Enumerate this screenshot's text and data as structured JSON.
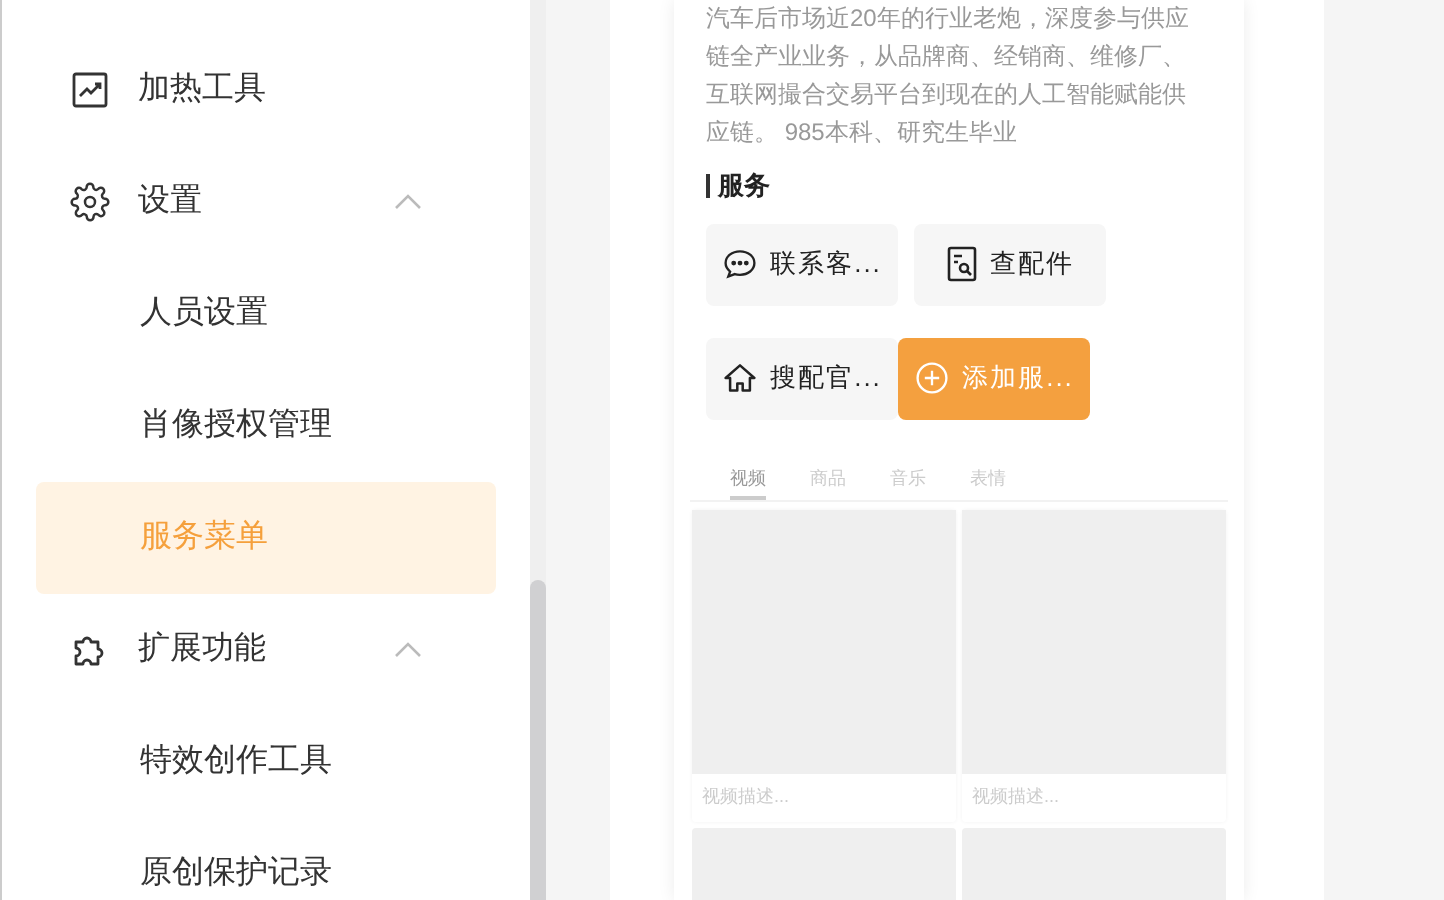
{
  "sidebar": {
    "items": [
      {
        "label": "加热工具",
        "kind": "trend"
      },
      {
        "label": "设置",
        "kind": "gear",
        "expanded": true,
        "children": [
          {
            "label": "人员设置",
            "selected": false
          },
          {
            "label": "肖像授权管理",
            "selected": false
          },
          {
            "label": "服务菜单",
            "selected": true
          }
        ]
      },
      {
        "label": "扩展功能",
        "kind": "puzzle",
        "expanded": true,
        "children": [
          {
            "label": "特效创作工具",
            "selected": false
          },
          {
            "label": "原创保护记录",
            "selected": false
          }
        ]
      }
    ]
  },
  "profile": {
    "bio": "汽车后市场近20年的行业老炮，深度参与供应链全产业业务，从品牌商、经销商、维修厂、互联网撮合交易平台到现在的人工智能赋能供应链。 985本科、研究生毕业"
  },
  "services": {
    "title": "服务",
    "buttons": [
      {
        "label": "联系客...",
        "kind": "chat"
      },
      {
        "label": "查配件",
        "kind": "doc"
      },
      {
        "label": "搜配官...",
        "kind": "home"
      },
      {
        "label": "添加服...",
        "kind": "add"
      }
    ]
  },
  "tabs": [
    {
      "label": "视频",
      "selected": true
    },
    {
      "label": "商品",
      "selected": false
    },
    {
      "label": "音乐",
      "selected": false
    },
    {
      "label": "表情",
      "selected": false
    }
  ],
  "videos": [
    {
      "kind": "described",
      "description": "视频描述..."
    },
    {
      "kind": "described",
      "description": "视频描述..."
    },
    {
      "kind": "blank"
    },
    {
      "kind": "blank"
    }
  ]
}
